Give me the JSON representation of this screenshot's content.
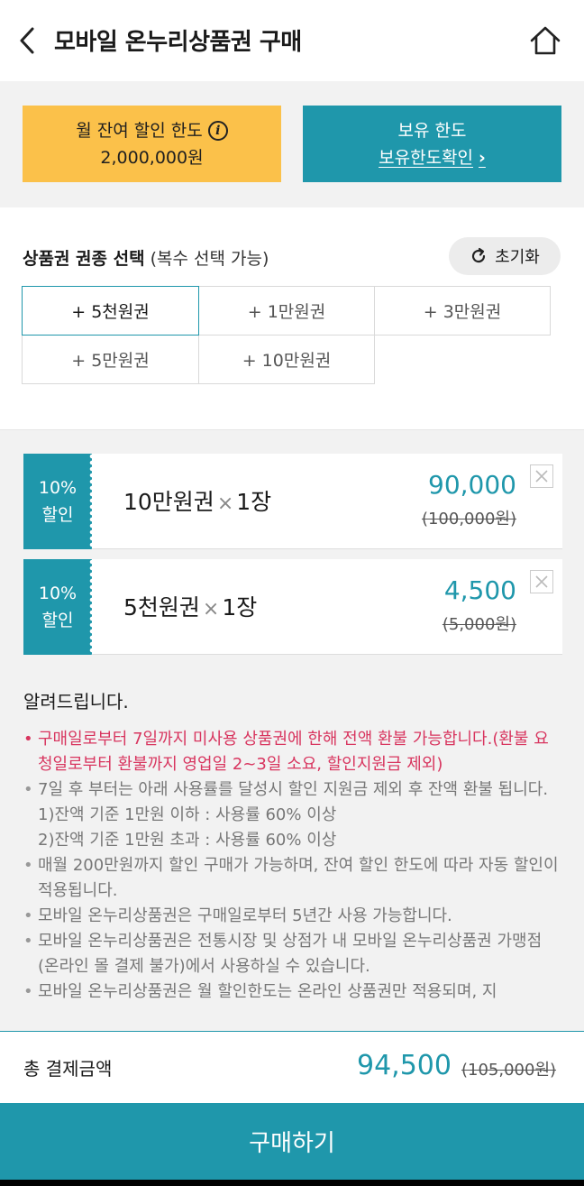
{
  "header": {
    "title": "모바일 온누리상품권 구매"
  },
  "limits": {
    "monthly_label": "월 잔여 할인 한도",
    "monthly_value": "2,000,000원",
    "own_label": "보유 한도",
    "own_link": "보유한도확인"
  },
  "selection": {
    "label": "상품권 권종 선택",
    "sub": "(복수 선택 가능)",
    "reset": "초기화",
    "options": [
      "+ 5천원권",
      "+ 1만원권",
      "+ 3만원권",
      "+ 5만원권",
      "+ 10만원권"
    ]
  },
  "cart": [
    {
      "discount": "10%",
      "discount_label": "할인",
      "name": "10만원권",
      "times": "×",
      "qty": "1장",
      "price": "90,000",
      "original": "(100,000원)"
    },
    {
      "discount": "10%",
      "discount_label": "할인",
      "name": "5천원권",
      "times": "×",
      "qty": "1장",
      "price": "4,500",
      "original": "(5,000원)"
    }
  ],
  "notice": {
    "title": "알려드립니다.",
    "items": [
      "구매일로부터 7일까지 미사용 상품권에 한해 전액 환불 가능합니다.(환불 요청일로부터 환불까지 영업일 2~3일 소요, 할인지원금 제외)",
      "7일 후 부터는 아래 사용률를 달성시 할인 지원금 제외 후 잔액 환불 됩니다.",
      "1)잔액 기준 1만원 이하 : 사용률 60% 이상",
      "2)잔액 기준 1만원 초과 : 사용률 60% 이상",
      "매월 200만원까지 할인 구매가 가능하며, 잔여 할인 한도에 따라 자동 할인이 적용됩니다.",
      "모바일 온누리상품권은 구매일로부터 5년간 사용 가능합니다.",
      "모바일 온누리상품권은 전통시장 및 상점가 내 모바일 온누리상품권 가맹점(온라인 몰 결제 불가)에서 사용하실 수 있습니다.",
      "모바일 온누리상품권은 월 할인한도는 온라인 상품권만 적용되며, 지"
    ]
  },
  "total": {
    "label": "총 결제금액",
    "amount": "94,500",
    "original": "(105,000원)"
  },
  "buy": {
    "label": "구매하기"
  },
  "colors": {
    "accent": "#1f97ab",
    "yellow": "#fbc14a",
    "red": "#d8355f"
  }
}
